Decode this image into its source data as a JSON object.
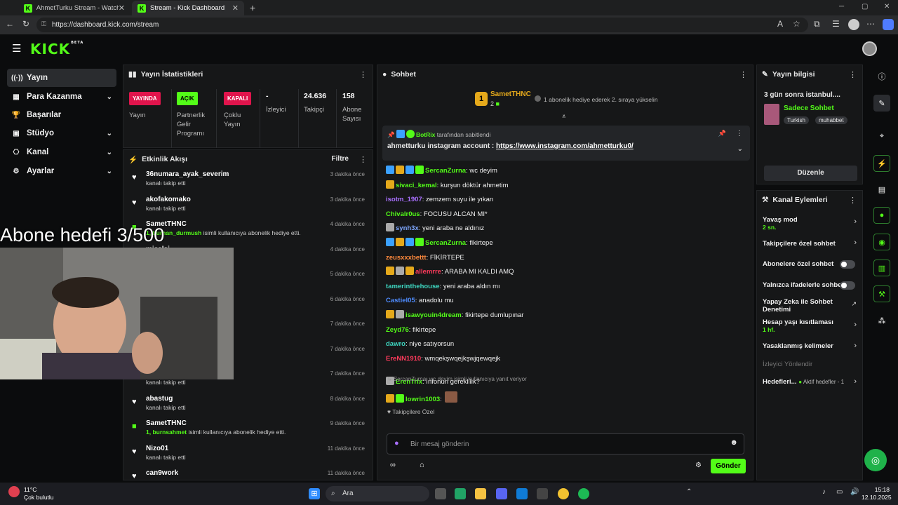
{
  "browser": {
    "tabs": [
      {
        "title": "AhmetTurku Stream - Watch Live"
      },
      {
        "title": "Stream - Kick Dashboard"
      }
    ],
    "url": "https://dashboard.kick.com/stream"
  },
  "logo": "KICK",
  "logo_badge": "BETA",
  "sidebar": {
    "items": [
      {
        "label": "Yayın"
      },
      {
        "label": "Para Kazanma"
      },
      {
        "label": "Başarılar"
      },
      {
        "label": "Stüdyo"
      },
      {
        "label": "Kanal"
      },
      {
        "label": "Ayarlar"
      }
    ]
  },
  "stats": {
    "title": "Yayın İstatistikleri",
    "live_badge": "YAYINDA",
    "live_label": "Yayın",
    "partner_badge": "AÇIK",
    "partner_label": "Partnerlik Gelir Programı",
    "multi_badge": "KAPALI",
    "multi_label": "Çoklu Yayın",
    "viewers_value": "-",
    "viewers_label": "İzleyici",
    "followers_value": "24.636",
    "followers_label": "Takipçi",
    "subs_value": "158",
    "subs_label": "Abone Sayısı"
  },
  "activity": {
    "title": "Etkinlik Akışı",
    "filter": "Filtre",
    "events": [
      {
        "name": "36numara_ayak_severim",
        "sub": "kanalı takip etti",
        "time": "3 dakika önce"
      },
      {
        "name": "akofakomako",
        "sub": "kanalı takip etti",
        "time": "3 dakika önce"
      },
      {
        "name": "SametTHNC",
        "sub": "isimli kullanıcıya abonelik hediye etti.",
        "sub_user": "1, burhan_durmush",
        "time": "4 dakika önce"
      },
      {
        "name": "micelsi",
        "sub": "",
        "time": "4 dakika önce"
      },
      {
        "name": "",
        "sub": "",
        "time": "5 dakika önce"
      },
      {
        "name": "",
        "sub": "",
        "time": "6 dakika önce"
      },
      {
        "name": "",
        "sub": "",
        "time": "7 dakika önce"
      },
      {
        "name": "",
        "sub": "",
        "time": "7 dakika önce"
      },
      {
        "name": "",
        "sub": "kanalı takip etti",
        "time": "7 dakika önce"
      },
      {
        "name": "abastug",
        "sub": "kanalı takip etti",
        "time": "8 dakika önce"
      },
      {
        "name": "SametTHNC",
        "sub": "isimli kullanıcıya abonelik hediye etti.",
        "sub_user": "1, burnsahmet",
        "time": "9 dakika önce"
      },
      {
        "name": "Nizo01",
        "sub": "kanalı takip etti",
        "time": "11 dakika önce"
      },
      {
        "name": "can9work",
        "sub": "",
        "time": "11 dakika önce"
      }
    ]
  },
  "overlay": {
    "goal_text": "Abone hedefi 3/500"
  },
  "chat": {
    "title": "Sohbet",
    "top_gifter": {
      "rank": "1",
      "name": "SametTHNC",
      "count": "2",
      "promo": "1 abonelik hediye ederek 2. sıraya yükselin"
    },
    "pinned": {
      "by_user": "BotRix",
      "by_text": "tarafından sabitlendi",
      "text": "ahmetturku instagram account : ",
      "link": "https://www.instagram.com/ahmetturku0/"
    },
    "messages": [
      {
        "user": "SercanZurna",
        "text": ": wc deyim",
        "color": "#53fc18"
      },
      {
        "user": "sivaci_kemal",
        "text": ": kurşun döktür ahmetim",
        "color": "#53fc18"
      },
      {
        "user": "isotm_1907",
        "text": ": zemzem suyu ile yıkan",
        "color": "#a970ff"
      },
      {
        "user": "Chivalr0us",
        "text": ": FOCUSU ALCAN MI*",
        "color": "#53fc18"
      },
      {
        "user": "synh3x",
        "text": ": yeni araba ne aldınız",
        "color": "#7fa8ff"
      },
      {
        "user": "SercanZurna",
        "text": ": fikirtepe",
        "color": "#53fc18"
      },
      {
        "user": "zeusxxxbettt",
        "text": ": FİKİRTEPE",
        "color": "#ff8a3d"
      },
      {
        "user": "allemrre",
        "text": ": ARABA MI KALDI AMQ",
        "color": "#ff3b5c"
      },
      {
        "user": "tamerinthehouse",
        "text": ": yeni araba aldın mı",
        "color": "#3ed6c0"
      },
      {
        "user": "Castiel05",
        "text": ": anadolu mu",
        "color": "#4f8cff"
      },
      {
        "user": "isawyouin4dream",
        "text": ": fikirtepe dumlupınar",
        "color": "#53fc18"
      },
      {
        "user": "Zeyd76",
        "text": ": fikirtepe",
        "color": "#53fc18"
      },
      {
        "user": "dawro",
        "text": ": niye satıyorsun",
        "color": "#3ed6c0"
      },
      {
        "user": "EreNN1910",
        "text": ": wmqekşwqejkşwjqewqejk",
        "color": "#ff3b5c"
      }
    ],
    "reply_hint": "SercanZurna: wc deyim isimli kullanıcıya yanıt veriyor",
    "reply": {
      "user": "ErenTrix",
      "text": ": İnfonun gereklilik?",
      "color": "#53fc18"
    },
    "last": {
      "user": "lowrin1003",
      "text": ":",
      "color": "#53fc18"
    },
    "followers_only": "Takipçilere Özel",
    "input_placeholder": "Bir mesaj gönderin",
    "send_label": "Gönder"
  },
  "info": {
    "title": "Yayın bilgisi",
    "stream_title": "3 gün sonra istanbul....",
    "category": "Sadece Sohbet",
    "tags": [
      "Turkish",
      "muhabbet"
    ],
    "edit_label": "Düzenle"
  },
  "actions": {
    "title": "Kanal Eylemleri",
    "slow_mode": "Yavaş mod",
    "slow_value": "2 sn.",
    "followers_chat": "Takipçilere özel sohbet",
    "subs_chat": "Abonelere özel sohbet",
    "emote_chat": "Yalnızca ifadelerle sohbet",
    "ai_chat": "Yapay Zeka ile Sohbet Denetimi",
    "age": "Hesap yaşı kısıtlaması",
    "age_value": "1 hf.",
    "banned": "Yasaklanmış kelimeler",
    "redirect": "İzleyici Yönlendir",
    "goals": "Hedefleri...",
    "goals_value": "Aktif hedefler - 1"
  },
  "taskbar": {
    "temp": "11°C",
    "weather": "Çok bulutlu",
    "search": "Ara",
    "time": "15:18",
    "date": "12.10.2025"
  },
  "colors": {
    "accent": "#53fc18",
    "live": "#e0144c"
  }
}
